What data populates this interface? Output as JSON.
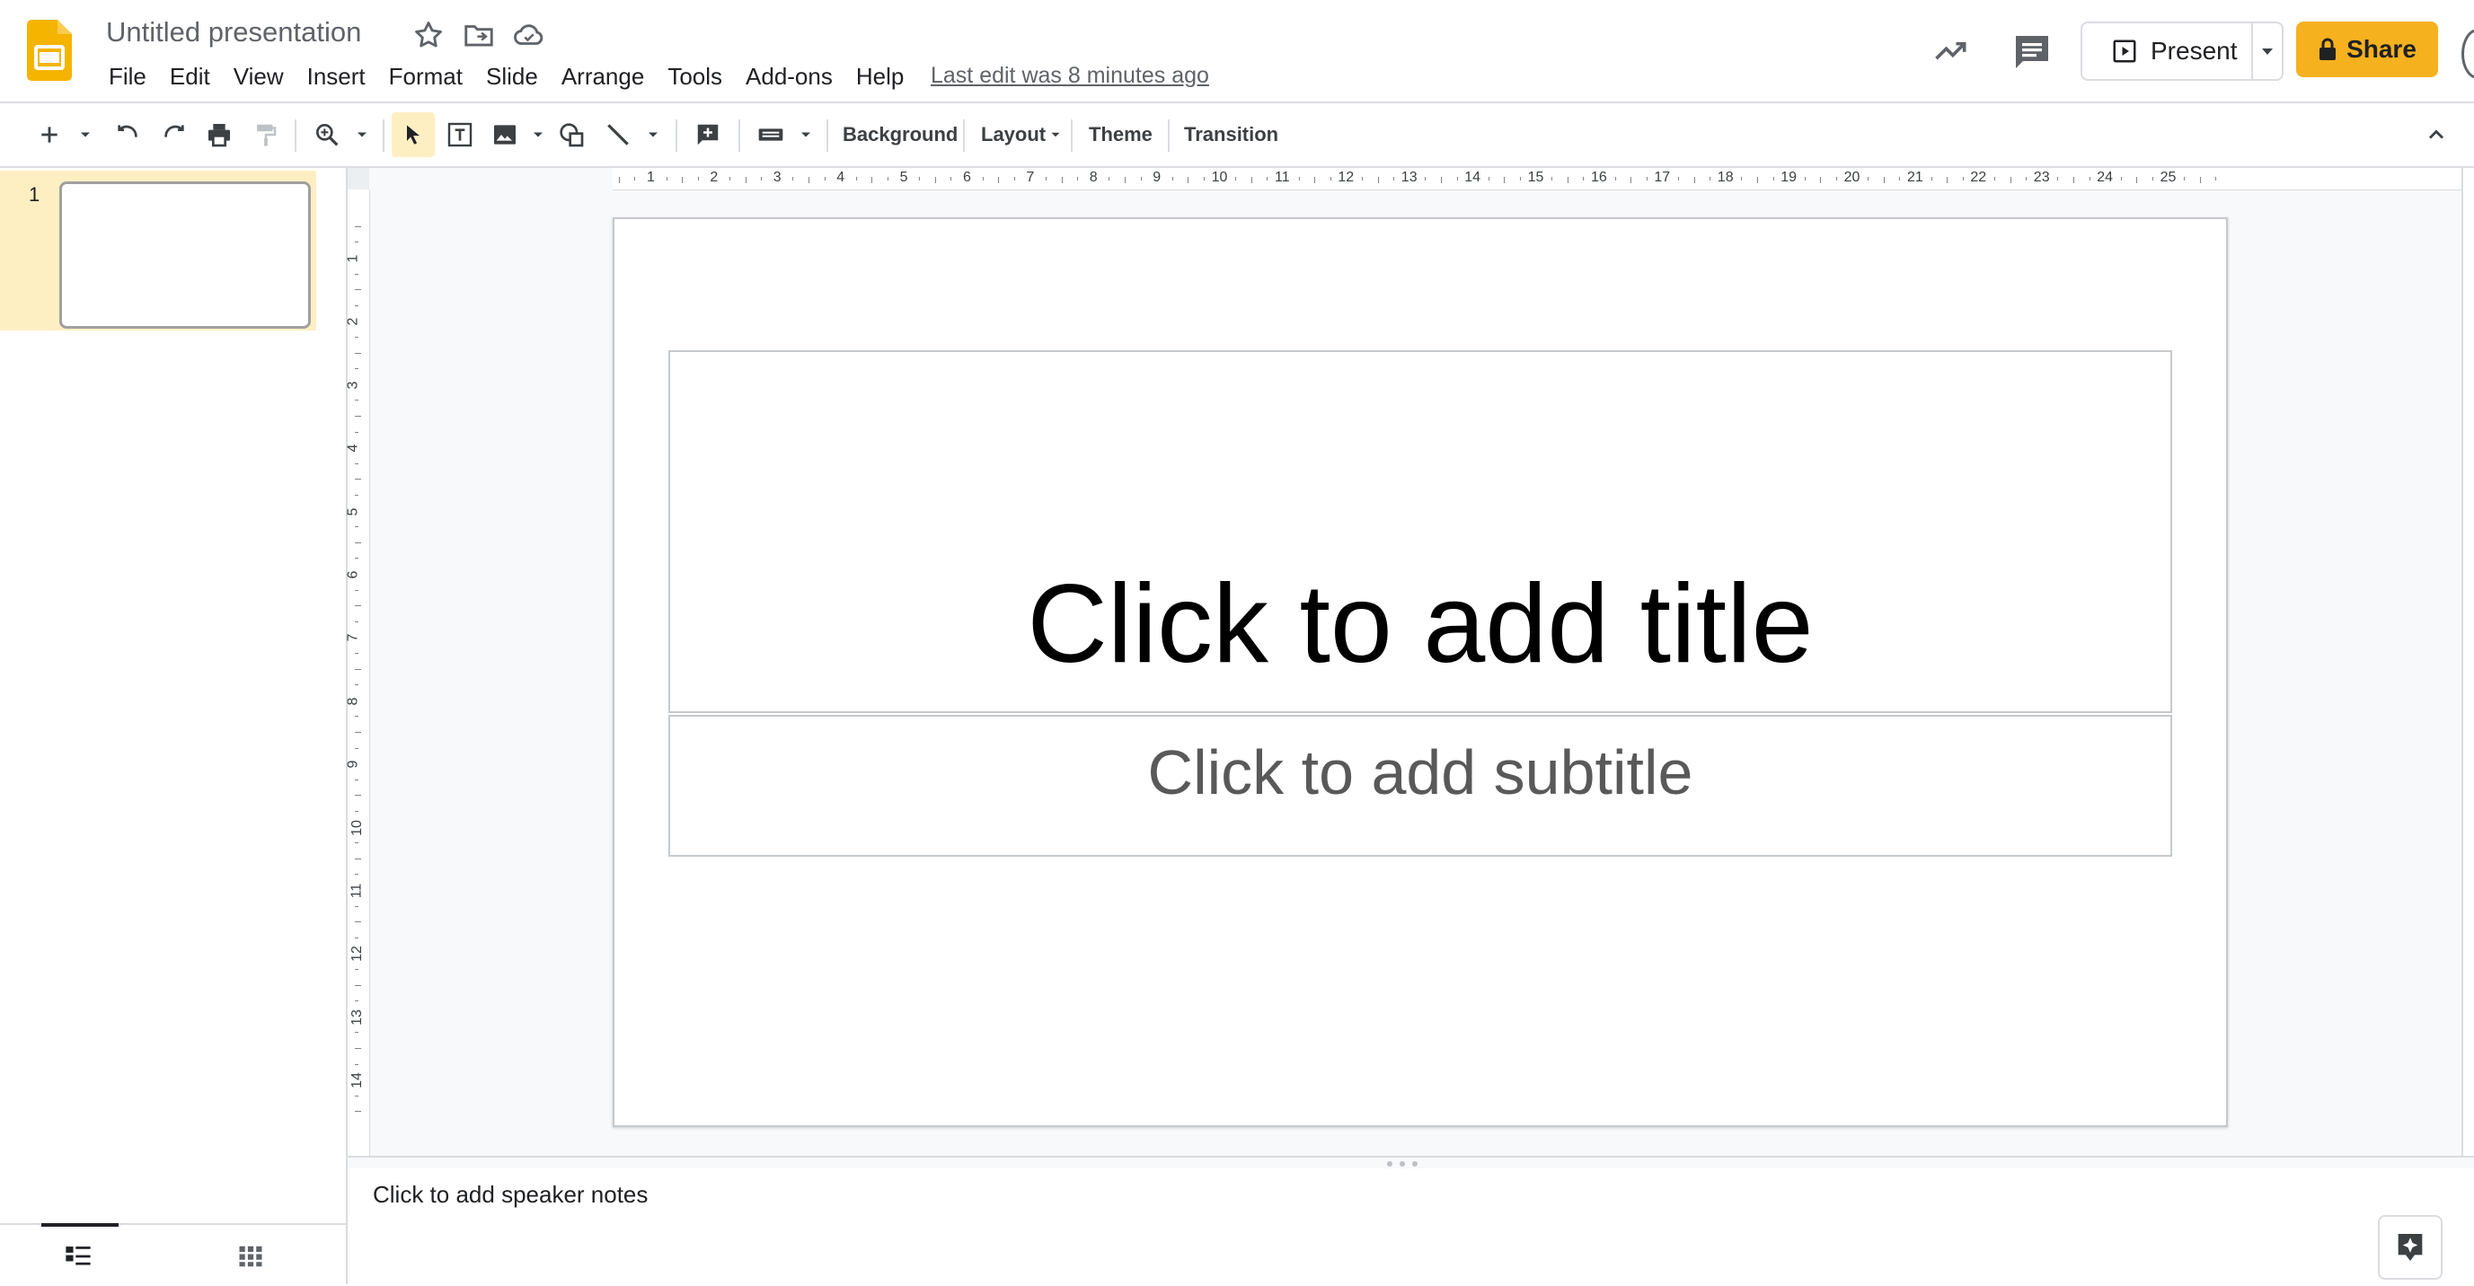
{
  "header": {
    "title": "Untitled presentation",
    "last_edit": "Last edit was 8 minutes ago",
    "menu": [
      "File",
      "Edit",
      "View",
      "Insert",
      "Format",
      "Slide",
      "Arrange",
      "Tools",
      "Add-ons",
      "Help"
    ],
    "present_label": "Present",
    "share_label": "Share"
  },
  "toolbar": {
    "background_label": "Background",
    "layout_label": "Layout",
    "theme_label": "Theme",
    "transition_label": "Transition"
  },
  "filmstrip": {
    "slides": [
      {
        "number": "1"
      }
    ]
  },
  "ruler": {
    "horizontal": [
      "1",
      "2",
      "3",
      "4",
      "5",
      "6",
      "7",
      "8",
      "9",
      "10",
      "11",
      "12",
      "13",
      "14",
      "15",
      "16",
      "17",
      "18",
      "19",
      "20",
      "21",
      "22",
      "23",
      "24",
      "25"
    ],
    "vertical": [
      "1",
      "2",
      "3",
      "4",
      "5",
      "6",
      "7",
      "8",
      "9",
      "10",
      "11",
      "12",
      "13",
      "14"
    ]
  },
  "slide": {
    "title_placeholder": "Click to add title",
    "subtitle_placeholder": "Click to add subtitle"
  },
  "notes": {
    "placeholder": "Click to add speaker notes"
  },
  "colors": {
    "accent": "#f6b11f",
    "selection": "#feefc3",
    "border": "#dadce0",
    "icon": "#5f6368"
  },
  "icons": [
    "slides-logo",
    "star-icon",
    "move-to-folder-icon",
    "cloud-saved-icon",
    "activity-icon",
    "comments-icon",
    "present-icon",
    "lock-icon",
    "new-slide-icon",
    "undo-icon",
    "redo-icon",
    "print-icon",
    "paint-format-icon",
    "zoom-icon",
    "select-icon",
    "text-box-icon",
    "image-icon",
    "shape-icon",
    "line-icon",
    "comment-add-icon",
    "keyboard-icon",
    "collapse-icon",
    "list-view-icon",
    "grid-view-icon",
    "explore-icon"
  ]
}
